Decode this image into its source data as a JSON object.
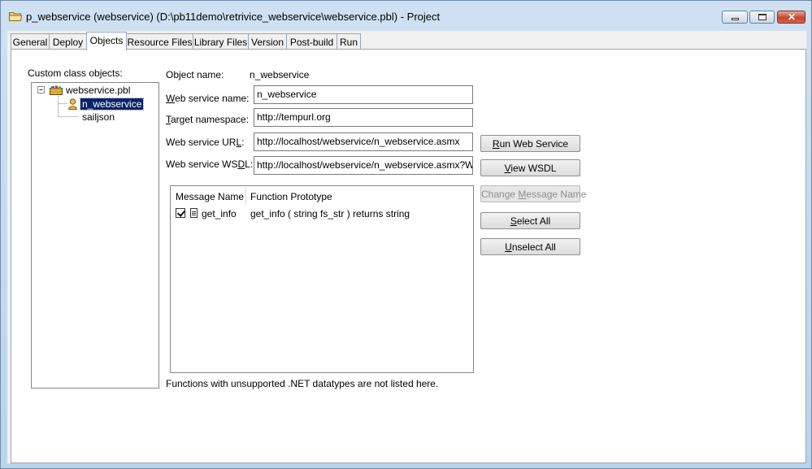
{
  "window": {
    "title": "p_webservice (webservice) (D:\\pb11demo\\retrivice_webservice\\webservice.pbl) - Project",
    "controls": {
      "minimize": "minimize",
      "maximize": "maximize",
      "close": "✕"
    }
  },
  "tabs": [
    "General",
    "Deploy",
    "Objects",
    "Resource Files",
    "Library Files",
    "Version",
    "Post-build",
    "Run"
  ],
  "active_tab": "Objects",
  "objects": {
    "custom_class_label": "Custom class objects:",
    "tree": {
      "root": "webservice.pbl",
      "children": [
        {
          "label": "n_webservice",
          "selected": true
        },
        {
          "label": "sailjson",
          "selected": false
        }
      ]
    },
    "object_name_label": "Object name:",
    "object_name_value": "n_webservice",
    "ws_name_label_hot": "W",
    "ws_name_label_rest": "eb service name:",
    "ws_name_value": "n_webservice",
    "target_ns_label_hot": "T",
    "target_ns_label_rest": "arget namespace:",
    "target_ns_value": "http://tempurl.org",
    "ws_url_label_pre": "Web service UR",
    "ws_url_label_hot": "L",
    "ws_url_label_post": ":",
    "ws_url_value": "http://localhost/webservice/n_webservice.asmx",
    "ws_wsdl_label_pre": "Web service WS",
    "ws_wsdl_label_hot": "D",
    "ws_wsdl_label_post": "L:",
    "ws_wsdl_value": "http://localhost/webservice/n_webservice.asmx?WSDL",
    "columns": [
      "Message Name",
      "Function Prototype"
    ],
    "rows": [
      {
        "checked": true,
        "name": "get_info",
        "prototype": "get_info ( string fs_str )  returns string"
      }
    ],
    "footnote": "Functions with unsupported .NET datatypes are not listed here."
  },
  "buttons": {
    "run_hot": "R",
    "run_rest": "un Web Service",
    "view_hot": "V",
    "view_rest": "iew WSDL",
    "change_pre": "Change ",
    "change_hot": "M",
    "change_rest": "essage Name",
    "select_pre": "",
    "select_hot": "S",
    "select_rest": "elect All",
    "unselect_hot": "U",
    "unselect_rest": "nselect All"
  },
  "colors": {
    "selection": "#0a246a",
    "panel": "#ffffff",
    "frame": "#dbe7f4"
  }
}
